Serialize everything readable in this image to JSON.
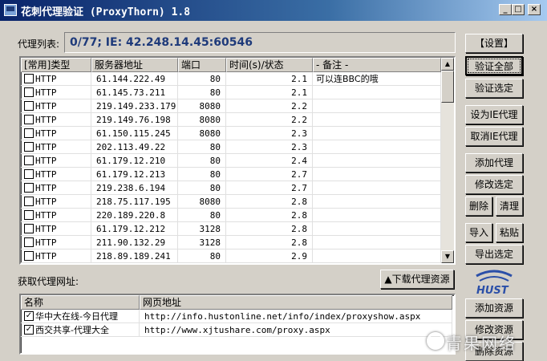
{
  "window": {
    "title": "花刺代理验证 (ProxyThorn) 1.8"
  },
  "status": {
    "label": "代理列表:",
    "text": "0/77;   IE: 42.248.14.45:60546"
  },
  "proxy_table": {
    "columns": [
      "[常用]类型",
      "服务器地址",
      "端口",
      "时间(s)/状态",
      "- 备注 -"
    ],
    "rows": [
      {
        "type": "HTTP",
        "address": "61.144.222.49",
        "port": "80",
        "time": "2.1",
        "note": "可以连BBC的哦"
      },
      {
        "type": "HTTP",
        "address": "61.145.73.211",
        "port": "80",
        "time": "2.1",
        "note": ""
      },
      {
        "type": "HTTP",
        "address": "219.149.233.179",
        "port": "8080",
        "time": "2.2",
        "note": ""
      },
      {
        "type": "HTTP",
        "address": "219.149.76.198",
        "port": "8080",
        "time": "2.2",
        "note": ""
      },
      {
        "type": "HTTP",
        "address": "61.150.115.245",
        "port": "8080",
        "time": "2.3",
        "note": ""
      },
      {
        "type": "HTTP",
        "address": "202.113.49.22",
        "port": "80",
        "time": "2.3",
        "note": ""
      },
      {
        "type": "HTTP",
        "address": "61.179.12.210",
        "port": "80",
        "time": "2.4",
        "note": ""
      },
      {
        "type": "HTTP",
        "address": "61.179.12.213",
        "port": "80",
        "time": "2.7",
        "note": ""
      },
      {
        "type": "HTTP",
        "address": "219.238.6.194",
        "port": "80",
        "time": "2.7",
        "note": ""
      },
      {
        "type": "HTTP",
        "address": "218.75.117.195",
        "port": "8080",
        "time": "2.8",
        "note": ""
      },
      {
        "type": "HTTP",
        "address": "220.189.220.8",
        "port": "80",
        "time": "2.8",
        "note": ""
      },
      {
        "type": "HTTP",
        "address": "61.179.12.212",
        "port": "3128",
        "time": "2.8",
        "note": ""
      },
      {
        "type": "HTTP",
        "address": "211.90.132.29",
        "port": "3128",
        "time": "2.8",
        "note": ""
      },
      {
        "type": "HTTP",
        "address": "218.89.189.241",
        "port": "80",
        "time": "2.9",
        "note": ""
      }
    ]
  },
  "fetch": {
    "label": "获取代理网址:",
    "download_button": "▲下载代理资源"
  },
  "source_table": {
    "columns": [
      "名称",
      "网页地址"
    ],
    "rows": [
      {
        "checked": true,
        "name": "华中大在线-今日代理",
        "url": "http://info.hustonline.net/info/index/proxyshow.aspx"
      },
      {
        "checked": true,
        "name": "西交共享-代理大全",
        "url": "http://www.xjtushare.com/proxy.aspx"
      }
    ]
  },
  "buttons": {
    "settings": "【设置】",
    "verify_all": "验证全部",
    "verify_selected": "验证选定",
    "set_ie_proxy": "设为IE代理",
    "cancel_ie_proxy": "取消IE代理",
    "add_proxy": "添加代理",
    "edit_selected": "修改选定",
    "delete": "删除",
    "clean": "清理",
    "import": "导入",
    "paste": "粘贴",
    "export_selected": "导出选定",
    "add_source": "添加资源",
    "edit_source": "修改资源",
    "delete_source": "删除资源"
  },
  "logo": {
    "text": "HUST"
  },
  "watermark": {
    "text": "青果网络"
  },
  "colors": {
    "title_start": "#0a246a",
    "title_end": "#a6caf0",
    "status_text": "#1e3a7a",
    "face": "#d4d0c8"
  }
}
